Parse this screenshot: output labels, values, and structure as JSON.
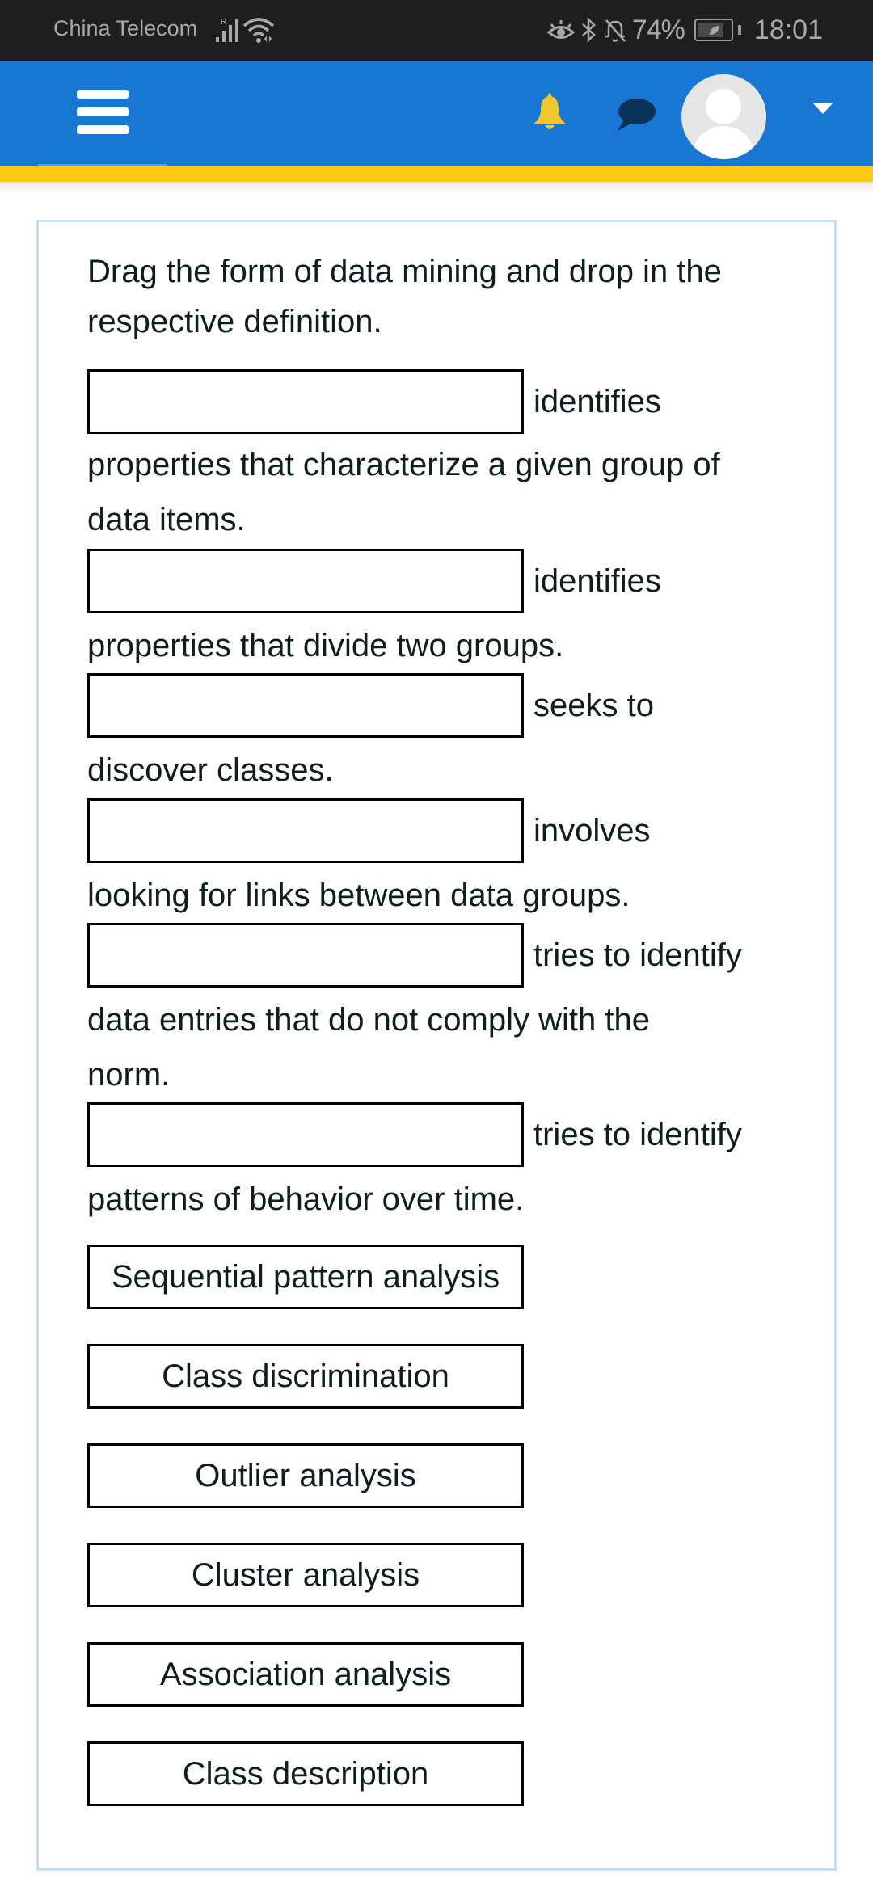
{
  "status_bar": {
    "carrier": "China Telecom",
    "roaming_indicator": "R",
    "battery_percent": "74%",
    "time": "18:01",
    "icons": [
      "signal-icon",
      "wifi-icon",
      "eye-comfort-icon",
      "bluetooth-icon",
      "mute-icon",
      "battery-saver-icon"
    ]
  },
  "navbar": {
    "menu_icon": "hamburger-icon",
    "notifications_icon": "bell-icon",
    "messages_icon": "chat-bubble-icon",
    "user_avatar": "user-avatar-icon",
    "user_menu_icon": "caret-down-icon",
    "colors": {
      "bar": "#1777d2",
      "accent_stripe": "#fdc913",
      "bell": "#f0c629",
      "chat": "#0a3157"
    }
  },
  "question": {
    "instruction": [
      "Drag the form of data mining and drop in the",
      "respective definition."
    ],
    "items": [
      {
        "after_box": "identifies",
        "continuation": [
          "properties that characterize a given group of",
          "data items."
        ]
      },
      {
        "after_box": "identifies",
        "continuation": [
          "properties that divide two groups."
        ]
      },
      {
        "after_box": "seeks to",
        "continuation": [
          "discover classes."
        ]
      },
      {
        "after_box": "involves",
        "continuation": [
          "looking for links between data groups."
        ]
      },
      {
        "after_box": "tries to identify",
        "continuation": [
          "data entries that do not comply with the",
          "norm."
        ]
      },
      {
        "after_box": "tries to identify",
        "continuation": [
          "patterns of behavior over time."
        ]
      }
    ],
    "drop_zones_filled": [
      "",
      "",
      "",
      "",
      "",
      ""
    ],
    "options": [
      "Sequential pattern analysis",
      "Class discrimination",
      "Outlier analysis",
      "Cluster analysis",
      "Association analysis",
      "Class description"
    ]
  }
}
